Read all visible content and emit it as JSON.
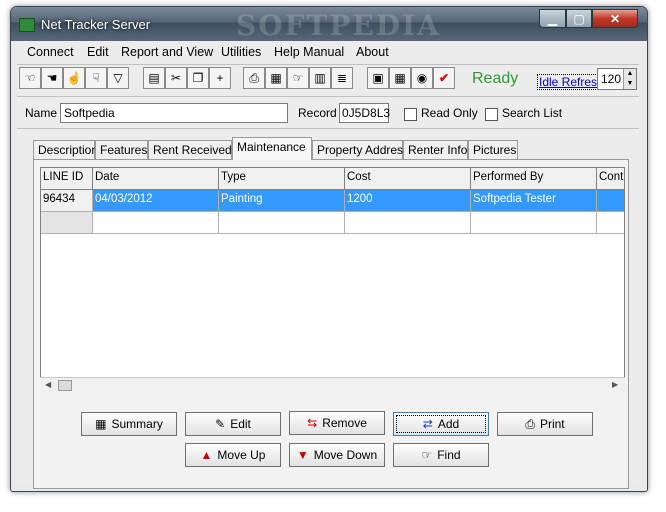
{
  "window": {
    "title": "Net Tracker Server",
    "watermark": "SOFTPEDIA"
  },
  "menu": [
    "Connect",
    "Edit",
    "Report and View",
    "Utilities",
    "Help Manual",
    "About"
  ],
  "toolbar": {
    "status": "Ready",
    "idle_link": "Idle Refresh",
    "refresh_value": "120"
  },
  "record_bar": {
    "name_label": "Name",
    "name_value": "Softpedia",
    "record_label": "Record",
    "record_value": "0J5D8L3",
    "read_only_label": "Read Only",
    "search_list_label": "Search List"
  },
  "tabs": [
    "Description",
    "Features",
    "Rent Received",
    "Maintenance",
    "Property Address",
    "Renter Info",
    "Pictures"
  ],
  "active_tab": "Maintenance",
  "grid": {
    "columns": [
      "LINE ID",
      "Date",
      "Type",
      "Cost",
      "Performed By",
      "Cont"
    ],
    "rows": [
      [
        "96434",
        "04/03/2012",
        "Painting",
        "1200",
        "Softpedia Tester",
        ""
      ]
    ]
  },
  "buttons": {
    "summary": "Summary",
    "edit": "Edit",
    "remove": "Remove",
    "add": "Add",
    "print": "Print",
    "move_up": "Move Up",
    "move_down": "Move Down",
    "find": "Find"
  },
  "colors": {
    "selection": "#3399ff",
    "ready": "#2f9a2f",
    "link": "#0000cc"
  }
}
